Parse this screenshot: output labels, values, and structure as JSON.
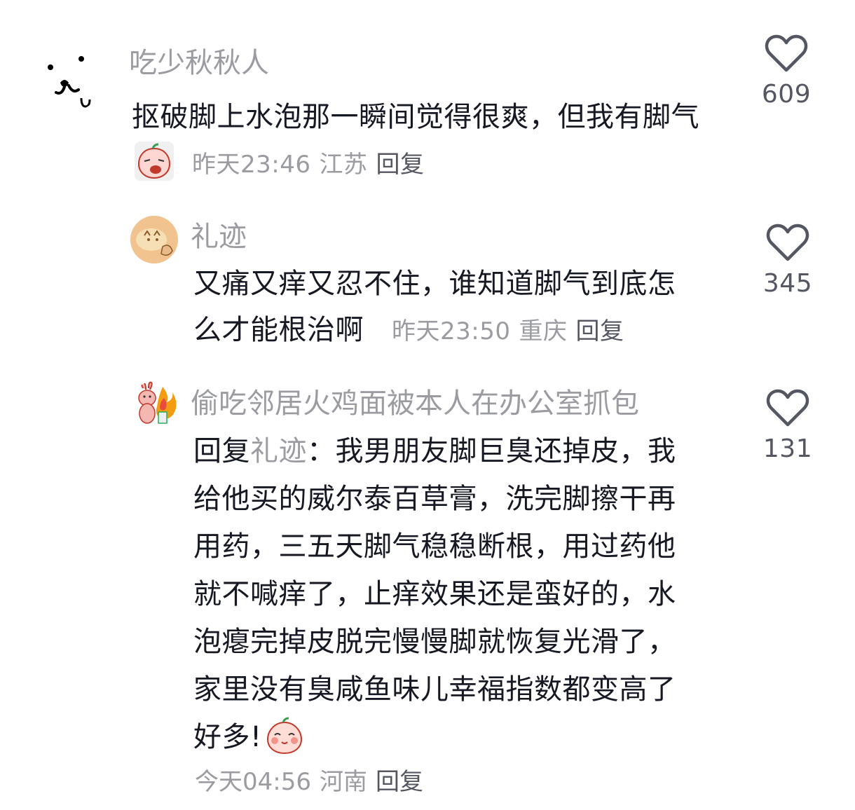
{
  "comments": [
    {
      "username": "吃少秋秋人",
      "text": "抠破脚上水泡那一瞬间觉得很爽，但我有脚气",
      "time": "昨天23:46",
      "location": "江苏",
      "reply_label": "回复",
      "likes": "609",
      "emoji_icon": "crying-peach-emoji"
    },
    {
      "username": "礼迹",
      "text": "又痛又痒又忍不住，谁知道脚气到底怎么才能根治啊",
      "time": "昨天23:50",
      "location": "重庆",
      "reply_label": "回复",
      "likes": "345"
    },
    {
      "username": "偷吃邻居火鸡面被本人在办公室抓包",
      "reply_prefix": "回复",
      "reply_target": "礼迹",
      "reply_colon": "：",
      "text": "我男朋友脚巨臭还掉皮，我给他买的威尔泰百草膏，洗完脚擦干再用药，三五天脚气稳稳断根，用过药他就不喊痒了，止痒效果还是蛮好的，水泡瘪完掉皮脱完慢慢脚就恢复光滑了，家里没有臭咸鱼味儿幸福指数都变高了好多!",
      "time": "今天04:56",
      "location": "河南",
      "reply_label": "回复",
      "likes": "131",
      "emoji_icon": "blushing-peach-emoji"
    }
  ],
  "icons": {
    "like": "heart-outline-icon"
  },
  "colors": {
    "username": "#9b9ca1",
    "text": "#161823",
    "meta": "#9b9ca1"
  }
}
